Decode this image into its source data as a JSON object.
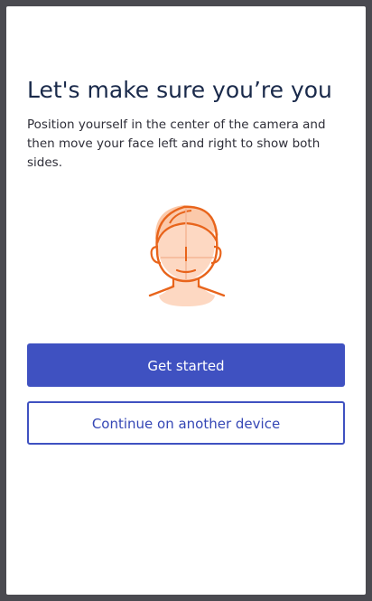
{
  "page": {
    "title": "Let's make sure you’re you",
    "description": "Position yourself in the center of the camera and then move your face left and right to show both sides."
  },
  "illustration": {
    "icon": "face-outline-icon",
    "stroke_color": "#e8641b",
    "fill_color": "#fdd8c2"
  },
  "buttons": {
    "primary_label": "Get started",
    "secondary_label": "Continue on another device"
  },
  "colors": {
    "accent": "#3f51c1",
    "title": "#19294a",
    "overlay": "#4a4a50"
  }
}
